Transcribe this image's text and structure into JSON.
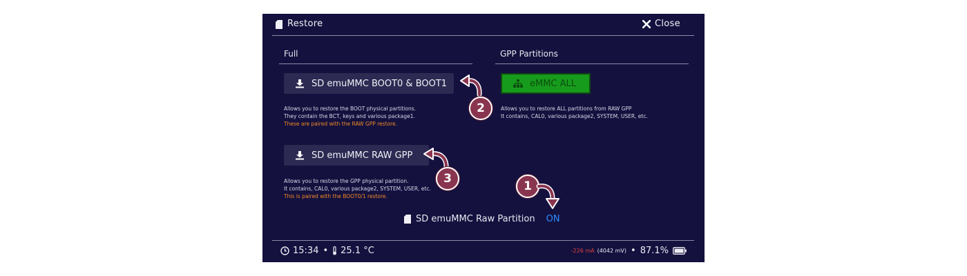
{
  "header": {
    "title": "Restore",
    "close_label": "Close"
  },
  "full": {
    "section_title": "Full",
    "boot_button": "SD emuMMC BOOT0 & BOOT1",
    "boot_desc_line1": "Allows you to restore the BOOT physical partitions.",
    "boot_desc_line2": "They contain the BCT, keys and various package1.",
    "boot_desc_warning": "These are paired with the RAW GPP restore.",
    "gpp_button": "SD emuMMC RAW GPP",
    "gpp_desc_line1": "Allows you to restore the GPP physical partition.",
    "gpp_desc_line2": "It contains, CAL0, various package2, SYSTEM, USER, etc.",
    "gpp_desc_warning": "This is paired with the BOOT0/1 restore."
  },
  "gpp_partitions": {
    "section_title": "GPP Partitions",
    "emmc_all_button": "eMMC ALL",
    "desc_line1": "Allows you to restore ALL partitions from RAW GPP",
    "desc_line2": "It contains, CAL0, various package2, SYSTEM, USER, etc."
  },
  "raw_partition": {
    "label": "SD emuMMC Raw Partition",
    "value": "ON"
  },
  "footer": {
    "time": "15:34",
    "temperature": "25.1 °C",
    "current": "-226 mA",
    "voltage": "(4042 mV)",
    "battery_percent": "87.1%"
  },
  "annotations": {
    "badge1": "1",
    "badge2": "2",
    "badge3": "3"
  },
  "colors": {
    "background": "#14113f",
    "button": "#2c2a52",
    "green_button": "#179b1c",
    "warning_text": "#f08a25",
    "toggle_on": "#2f8cff",
    "current_text": "#e0433b",
    "badge": "#8a3550"
  },
  "icons": [
    "sd-card-icon",
    "close-icon",
    "download-icon",
    "sitemap-icon",
    "clock-icon",
    "thermometer-icon",
    "battery-icon"
  ]
}
